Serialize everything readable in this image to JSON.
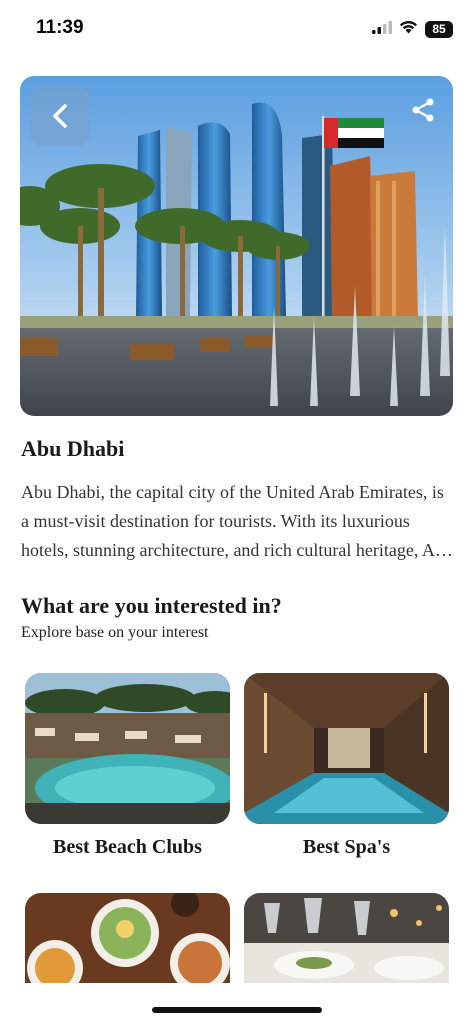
{
  "status": {
    "time": "11:39",
    "battery": "85",
    "icons": [
      "signal-icon",
      "wifi-icon",
      "battery-icon"
    ]
  },
  "hero": {
    "icons": [
      "back-chevron-icon",
      "share-icon"
    ]
  },
  "place": {
    "title": "Abu Dhabi",
    "description": "Abu Dhabi, the capital city of the United Arab Emirates, is a must-visit destination for tourists. With its luxurious hotels, stunning architecture, and rich cultural heritage, Abu Dhabi offers visitors an unforgettable experience."
  },
  "interests": {
    "title": "What are you interested in?",
    "subtitle": "Explore base on your interest",
    "cards": [
      {
        "label": "Best Beach Clubs"
      },
      {
        "label": "Best Spa's"
      },
      {
        "label": ""
      },
      {
        "label": ""
      }
    ]
  }
}
